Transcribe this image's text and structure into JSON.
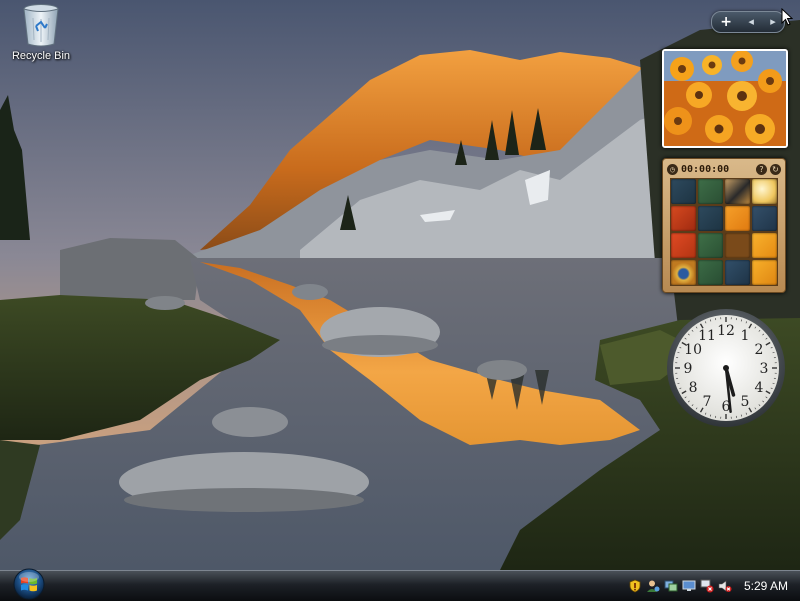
{
  "desktop": {
    "icons": [
      {
        "label": "Recycle Bin",
        "icon": "recycle-bin-icon"
      }
    ]
  },
  "sidebar": {
    "controls": {
      "add": "+",
      "prev": "◂",
      "next": "▸"
    },
    "gadgets": {
      "slideshow": {
        "subject": "orange daisies"
      },
      "puzzle": {
        "timer": "00:00:00"
      },
      "clock": {
        "numerals": [
          "12",
          "1",
          "2",
          "3",
          "4",
          "5",
          "6",
          "7",
          "8",
          "9",
          "10",
          "11"
        ],
        "time": "5:29"
      }
    }
  },
  "taskbar": {
    "start_icon": "windows-orb-icon",
    "tray": {
      "icons": [
        "security-shield-icon",
        "user-icon",
        "network-status-icon",
        "monitor-icon",
        "network-error-icon",
        "volume-muted-icon"
      ],
      "time": "5:29 AM"
    }
  },
  "colors": {
    "taskbar": "#1d2127",
    "accent_orange": "#e88a1a",
    "puzzle_frame": "#c79a62"
  }
}
